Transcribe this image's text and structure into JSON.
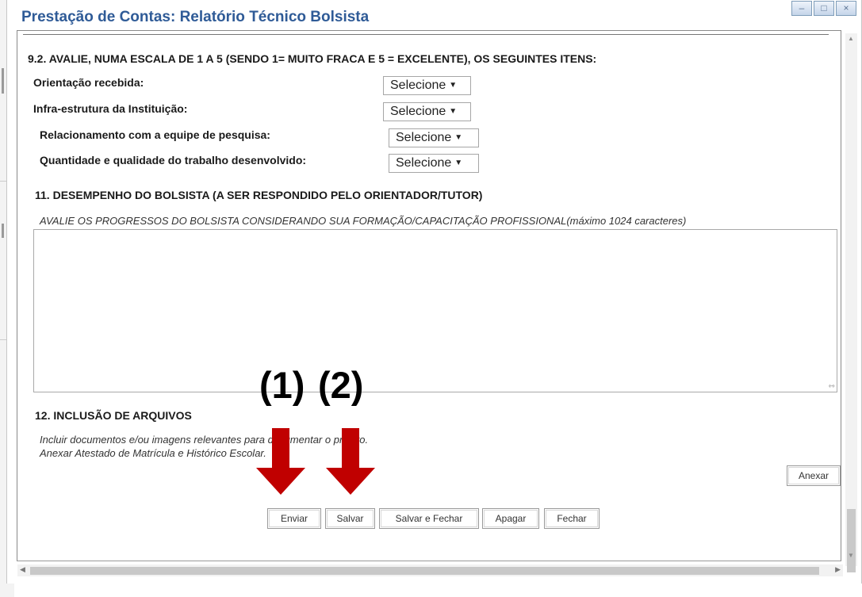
{
  "window": {
    "title": "Prestação de Contas: Relatório Técnico Bolsista",
    "controls": [
      "minimize-icon",
      "maximize-icon",
      "close-icon"
    ]
  },
  "section_9_2": {
    "heading": "9.2. AVALIE, NUMA ESCALA DE 1 A 5 (SENDO 1= MUITO FRACA E 5 = EXCELENTE), OS SEGUINTES ITENS:",
    "items": [
      {
        "label": "Orientação recebida:",
        "selected": "Selecione"
      },
      {
        "label": "Infra-estrutura da Instituição:",
        "selected": "Selecione"
      },
      {
        "label": "Relacionamento com a equipe de pesquisa:",
        "selected": "Selecione"
      },
      {
        "label": "Quantidade e qualidade do trabalho desenvolvido:",
        "selected": "Selecione"
      }
    ]
  },
  "section_11": {
    "heading": "11. DESEMPENHO DO BOLSISTA (A SER RESPONDIDO PELO ORIENTADOR/TUTOR)",
    "instruction": "AVALIE OS PROGRESSOS DO BOLSISTA CONSIDERANDO SUA FORMAÇÃO/CAPACITAÇÃO PROFISSIONAL(máximo 1024 caracteres)",
    "value": ""
  },
  "section_12": {
    "heading": "12. INCLUSÃO DE ARQUIVOS",
    "line1": "Incluir documentos e/ou imagens relevantes para documentar o projeto.",
    "line2": "Anexar Atestado de Matrícula e Histórico Escolar.",
    "attach_button": "Anexar"
  },
  "buttons": {
    "enviar": "Enviar",
    "salvar": "Salvar",
    "salvar_fechar": "Salvar e Fechar",
    "apagar": "Apagar",
    "fechar": "Fechar"
  },
  "annotations": {
    "label1": "(1)",
    "label2": "(2)",
    "arrow_color": "#c00000"
  },
  "colors": {
    "title": "#2f5b97"
  }
}
